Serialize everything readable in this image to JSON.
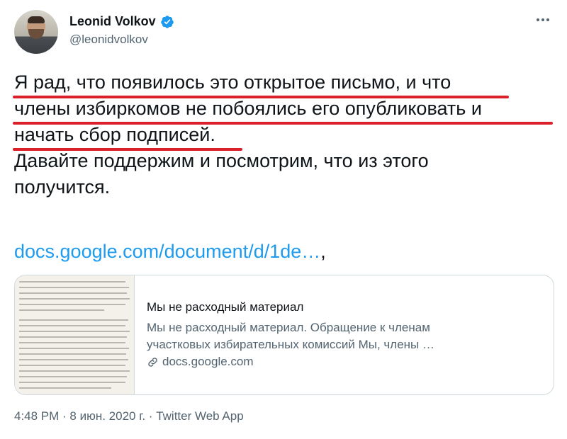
{
  "author": {
    "name": "Leonid Volkov",
    "handle": "@leonidvolkov",
    "verified": true,
    "avatar_icon": "avatar-photo"
  },
  "menu_icon": "more-horizontal-icon",
  "tweet": {
    "lines": [
      "Я рад, что появилось это открытое письмо, и что",
      "члены избиркомов не побоялись его опубликовать и",
      "начать сбор подписей.",
      "Давайте поддержим и посмотрим, что из этого",
      "получится."
    ],
    "link_text": "docs.google.com/document/d/1de…",
    "link_suffix": ","
  },
  "card": {
    "title": "Мы не расходный материал",
    "description_lines": [
      "Мы не расходный материал. Обращение к членам",
      "участковых избирательных комиссий Мы, члены …"
    ],
    "domain": "docs.google.com",
    "domain_icon": "link-icon"
  },
  "footer": {
    "time": "4:48 PM",
    "separator": " · ",
    "date": "8 июн. 2020 г.",
    "source": "Twitter Web App"
  },
  "colors": {
    "accent_link": "#1d9bf0",
    "verified_badge": "#1d9bf0",
    "underline_annotation": "#d9202b",
    "muted_text": "#536471"
  }
}
